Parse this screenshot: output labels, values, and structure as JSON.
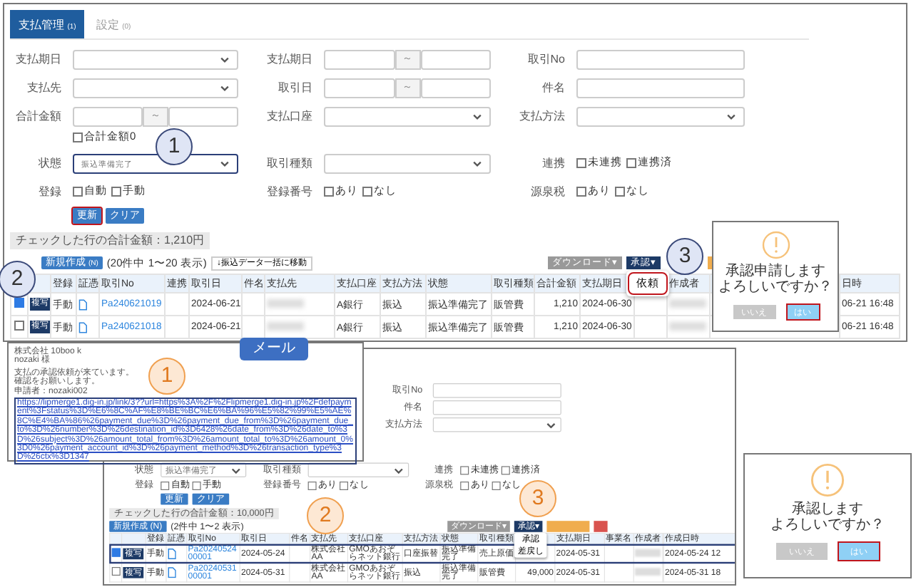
{
  "screens": [
    {
      "tabs": [
        {
          "label": "支払管理",
          "count": "(1)",
          "selected": true
        },
        {
          "label": "設定",
          "count": "(0)",
          "selected": false
        }
      ],
      "form_rows": [
        {
          "cells": [
            {
              "label": "支払期日",
              "kind": "select"
            },
            {
              "label": "支払期日",
              "kind": "range",
              "separator": "～"
            },
            {
              "label": "取引No",
              "kind": "input"
            }
          ]
        },
        {
          "cells": [
            {
              "label": "支払先",
              "kind": "select"
            },
            {
              "label": "取引日",
              "kind": "range",
              "separator": "～"
            },
            {
              "label": "件名",
              "kind": "input"
            }
          ]
        },
        {
          "cells": [
            {
              "label": "合計金額",
              "kind": "range",
              "separator": "～",
              "checks": [
                {
                  "label": "合計金額0",
                  "checked": false
                }
              ]
            },
            {
              "label": "支払口座",
              "kind": "select"
            },
            {
              "label": "支払方法",
              "kind": "select"
            }
          ]
        },
        {
          "cells": [
            {
              "label": "状態",
              "kind": "select",
              "value": "振込準備完了",
              "outlined": true
            },
            {
              "label": "取引種類",
              "kind": "select"
            },
            {
              "label": "連携",
              "kind": "checks",
              "checks": [
                {
                  "label": "未連携",
                  "checked": false
                },
                {
                  "label": "連携済",
                  "checked": false
                }
              ]
            }
          ]
        },
        {
          "cells": [
            {
              "label": "登録",
              "kind": "checks",
              "checks": [
                {
                  "label": "自動",
                  "checked": false
                },
                {
                  "label": "手動",
                  "checked": false
                }
              ]
            },
            {
              "label": "登録番号",
              "kind": "checks",
              "checks": [
                {
                  "label": "あり",
                  "checked": false
                },
                {
                  "label": "なし",
                  "checked": false
                }
              ]
            },
            {
              "label": "源泉税",
              "kind": "checks",
              "checks": [
                {
                  "label": "あり",
                  "checked": false
                },
                {
                  "label": "なし",
                  "checked": false
                }
              ]
            }
          ]
        }
      ],
      "buttons": [
        {
          "label": "更新",
          "outlined": true
        },
        {
          "label": "クリア",
          "outlined": false
        }
      ],
      "summary": "チェックした行の合計金額：1,210円",
      "new_button": "新規作成",
      "new_count": "(N)",
      "count_text": "(20件中 1〜20 表示)",
      "move_button": "↓振込データ一括に移動",
      "right_buttons": [
        {
          "label": "ダウンロード▾",
          "kind": "gray"
        },
        {
          "label": "承認▾",
          "kind": "navy",
          "menu": [
            {
              "label": "依頼",
              "outlined": true
            }
          ]
        },
        {
          "kind": "orange"
        }
      ],
      "columns": [
        "登録",
        "証憑",
        "取引No",
        "連携",
        "取引日",
        "件名",
        "支払先",
        "支払口座",
        "支払方法",
        "状態",
        "取引種類",
        "合計金額",
        "支払期日",
        null,
        "作成者"
      ],
      "tail_column": "日時",
      "rows": [
        {
          "checked": true,
          "action": "複写",
          "outlined": false,
          "tail": "06-21 16:48",
          "cells": [
            {
              "kind": "text",
              "text": "手動"
            },
            {
              "kind": "doc"
            },
            {
              "kind": "link",
              "text": "Pa240621019"
            },
            {
              "kind": "empty"
            },
            {
              "kind": "text",
              "text": "2024-06-21"
            },
            {
              "kind": "empty"
            },
            {
              "kind": "blurred"
            },
            {
              "kind": "text",
              "text": "A銀行"
            },
            {
              "kind": "text",
              "text": "振込"
            },
            {
              "kind": "text",
              "text": "振込準備完了"
            },
            {
              "kind": "text",
              "text": "販管費"
            },
            {
              "kind": "num",
              "text": "1,210"
            },
            {
              "kind": "text",
              "text": "2024-06-30"
            },
            {
              "kind": "empty"
            },
            {
              "kind": "blurred"
            }
          ]
        },
        {
          "checked": false,
          "action": "複写",
          "outlined": false,
          "tail": "06-21 16:48",
          "cells": [
            {
              "kind": "text",
              "text": "手動"
            },
            {
              "kind": "doc"
            },
            {
              "kind": "link",
              "text": "Pa240621018"
            },
            {
              "kind": "empty"
            },
            {
              "kind": "text",
              "text": "2024-06-21"
            },
            {
              "kind": "empty"
            },
            {
              "kind": "blurred"
            },
            {
              "kind": "text",
              "text": "A銀行"
            },
            {
              "kind": "text",
              "text": "振込"
            },
            {
              "kind": "text",
              "text": "振込準備完了"
            },
            {
              "kind": "text",
              "text": "販管費"
            },
            {
              "kind": "num",
              "text": "1,210"
            },
            {
              "kind": "text",
              "text": "2024-06-30"
            },
            {
              "kind": "empty"
            },
            {
              "kind": "blurred"
            }
          ]
        }
      ]
    },
    {
      "top_fields": [
        {
          "label": "取引No",
          "kind": "input"
        },
        {
          "label": "件名",
          "kind": "input"
        },
        {
          "label": "支払方法",
          "kind": "select"
        }
      ],
      "form_rows": [
        {
          "cells": [
            {
              "label": "状態",
              "kind": "select",
              "value": "振込準備完了",
              "outlined": false
            },
            {
              "label": "取引種類",
              "kind": "select"
            },
            {
              "label": "連携",
              "kind": "checks",
              "checks": [
                {
                  "label": "未連携",
                  "checked": false
                },
                {
                  "label": "連携済",
                  "checked": false
                }
              ]
            }
          ]
        },
        {
          "cells": [
            {
              "label": "登録",
              "kind": "checks",
              "checks": [
                {
                  "label": "自動",
                  "checked": false
                },
                {
                  "label": "手動",
                  "checked": false
                }
              ]
            },
            {
              "label": "登録番号",
              "kind": "checks",
              "checks": [
                {
                  "label": "あり",
                  "checked": false
                },
                {
                  "label": "なし",
                  "checked": false
                }
              ]
            },
            {
              "label": "源泉税",
              "kind": "checks",
              "checks": [
                {
                  "label": "あり",
                  "checked": false
                },
                {
                  "label": "なし",
                  "checked": false
                }
              ]
            }
          ]
        }
      ],
      "buttons": [
        {
          "label": "更新",
          "outlined": false
        },
        {
          "label": "クリア",
          "outlined": false
        }
      ],
      "summary": "チェックした行の合計金額：10,000円",
      "new_button": "新規作成",
      "new_count": "(N)",
      "count_text": "(2件中 1〜2 表示)",
      "right_buttons": [
        {
          "label": "ダウンロード▾",
          "kind": "gray"
        },
        {
          "label": "承認▾",
          "kind": "navy",
          "menu": [
            {
              "label": "承認",
              "outlined": false
            },
            {
              "label": "差戻し",
              "outlined": false
            }
          ]
        },
        {
          "kind": "orange"
        },
        {
          "kind": "red"
        }
      ],
      "columns": [
        "登録",
        "証憑",
        "取引No",
        "取引日",
        "件名",
        "支払先",
        "支払口座",
        "支払方法",
        "状態",
        "取引種類",
        null,
        "支払期日",
        "事業名",
        "作成者"
      ],
      "tail_column": "作成日時",
      "rows": [
        {
          "checked": true,
          "action": "複写",
          "outlined": true,
          "tail": "2024-05-24 12",
          "cells": [
            {
              "kind": "text",
              "text": "手動"
            },
            {
              "kind": "doc"
            },
            {
              "kind": "link",
              "text": "Pa2024052400001"
            },
            {
              "kind": "text",
              "text": "2024-05-24"
            },
            {
              "kind": "empty"
            },
            {
              "kind": "text",
              "text": "株式会社AA"
            },
            {
              "kind": "text",
              "text": "GMOあおぞらネット銀行"
            },
            {
              "kind": "text",
              "text": "口座振替"
            },
            {
              "kind": "text",
              "text": "振込準備完了"
            },
            {
              "kind": "text",
              "text": "売上原価"
            },
            {
              "kind": "empty"
            },
            {
              "kind": "text",
              "text": "2024-05-31"
            },
            {
              "kind": "empty"
            },
            {
              "kind": "blurred"
            }
          ]
        },
        {
          "checked": false,
          "action": "複写",
          "outlined": false,
          "tail": "2024-05-31 18",
          "cells": [
            {
              "kind": "text",
              "text": "手動"
            },
            {
              "kind": "doc"
            },
            {
              "kind": "link",
              "text": "Pa2024053100001"
            },
            {
              "kind": "text",
              "text": "2024-05-31"
            },
            {
              "kind": "empty"
            },
            {
              "kind": "text",
              "text": "株式会社AA"
            },
            {
              "kind": "text",
              "text": "GMOあおぞらネット銀行"
            },
            {
              "kind": "text",
              "text": "振込"
            },
            {
              "kind": "text",
              "text": "振込準備完了"
            },
            {
              "kind": "text",
              "text": "販管費"
            },
            {
              "kind": "num",
              "text": "49,000"
            },
            {
              "kind": "text",
              "text": "2024-05-31"
            },
            {
              "kind": "empty"
            },
            {
              "kind": "blurred"
            }
          ]
        }
      ]
    }
  ],
  "email": {
    "tag": "メール",
    "header_lines": [
      "株式会社 10boo k",
      "nozaki 様"
    ],
    "body_lines": [
      "支払の承認依頼が来ています。",
      "確認をお願いします。",
      "申請者：nozaki002"
    ],
    "link": "https://lipmerge1.dig-in.jp/link/3??url=https%3A%2F%2Flipmerge1.dig-in.jp%2Fdefpayment%3Fstatus%3D%E6%8C%AF%E8%BE%BC%E6%BA%96%E5%82%99%E5%AE%8C%E4%BA%86%26payment_due%3D%26payment_due_from%3D%26payment_due_to%3D%26number%3D%26destination_id%3D6428%26date_from%3D%26date_to%3D%26subject%3D%26amount_total_from%3D%26amount_total_to%3D%26amount_0%3D0%26payment_account_id%3D%26payment_method%3D%26transaction_type%3D%26ctx%3D1347"
  },
  "dialogs": [
    {
      "lines": [
        "承認申請します",
        "よろしいですか？"
      ],
      "cancel": "いいえ",
      "ok": "はい"
    },
    {
      "lines": [
        "承認します",
        "よろしいですか？"
      ],
      "cancel": "いいえ",
      "ok": "はい"
    }
  ],
  "callouts": [
    {
      "number": "1",
      "kind": "blue"
    },
    {
      "number": "2",
      "kind": "blue"
    },
    {
      "number": "3",
      "kind": "blue"
    },
    {
      "number": "1",
      "kind": "orange"
    },
    {
      "number": "2",
      "kind": "orange"
    },
    {
      "number": "3",
      "kind": "orange"
    }
  ]
}
